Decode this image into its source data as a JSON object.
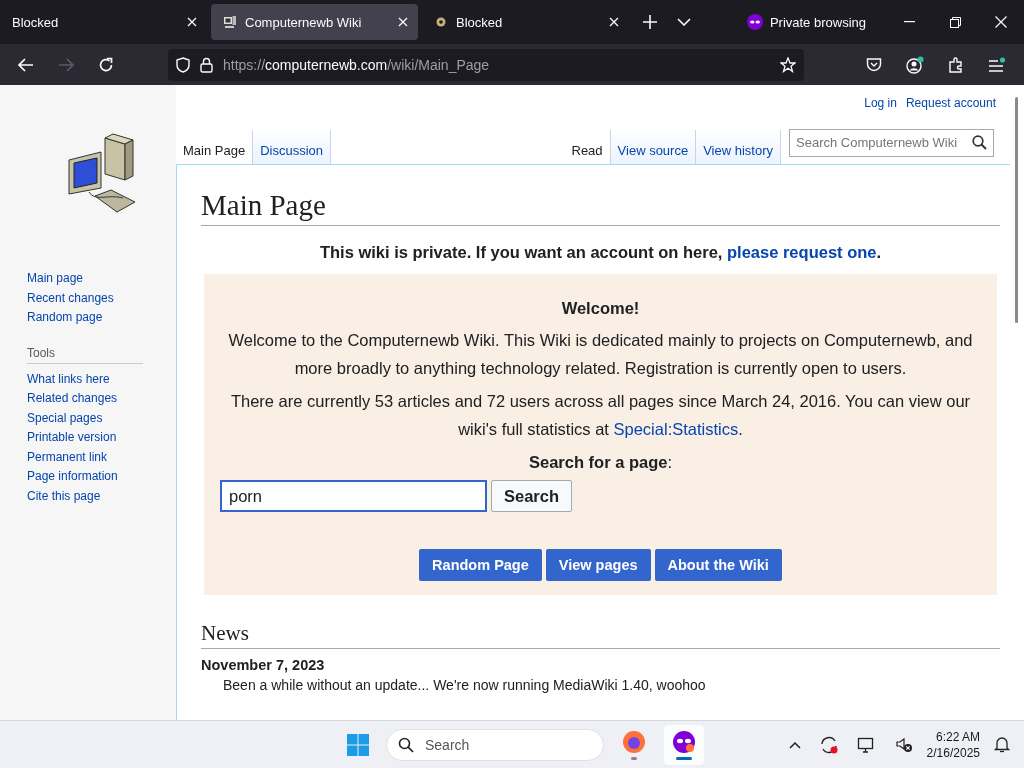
{
  "browser": {
    "tabs": [
      {
        "title": "Blocked",
        "selected": false,
        "kind": "plain"
      },
      {
        "title": "Computernewb Wiki",
        "selected": true,
        "kind": "wiki"
      },
      {
        "title": "Blocked",
        "selected": false,
        "kind": "blocked"
      }
    ],
    "private_label": "Private browsing",
    "forward_disabled": true,
    "url": {
      "scheme": "https://",
      "host": "computernewb.com",
      "path": "/wiki/Main_Page"
    }
  },
  "wiki": {
    "personal_links": [
      "Log in",
      "Request account"
    ],
    "page_tabs": [
      {
        "label": "Main Page",
        "selected": true
      },
      {
        "label": "Discussion",
        "selected": false
      }
    ],
    "view_tabs": [
      {
        "label": "Read",
        "selected": true
      },
      {
        "label": "View source",
        "selected": false
      },
      {
        "label": "View history",
        "selected": false
      }
    ],
    "search": {
      "placeholder": "Search Computernewb Wiki"
    },
    "navigation": [
      "Main page",
      "Recent changes",
      "Random page"
    ],
    "tools_heading": "Tools",
    "tools": [
      "What links here",
      "Related changes",
      "Special pages",
      "Printable version",
      "Permanent link",
      "Page information",
      "Cite this page"
    ],
    "title": "Main Page",
    "notice": {
      "text": "This wiki is private. If you want an account on here, ",
      "link": "please request one",
      "end": "."
    },
    "welcome": {
      "heading": "Welcome!",
      "paragraphs": [
        {
          "text": "Welcome to the Computernewb Wiki. This Wiki is dedicated mainly to projects on Computernewb, and more broadly to anything technology related. Registration is currently open to users."
        },
        {
          "text": "There are currently 53 articles and 72 users across all pages since March 24, 2016. You can view our wiki's full statistics at ",
          "link": "Special:Statistics",
          "end": "."
        }
      ],
      "search_label": "**Search for a page**:",
      "search_value": "porn",
      "search_button": "Search",
      "buttons": [
        "Random Page",
        "View pages",
        "About the Wiki"
      ]
    },
    "news": {
      "heading": "News",
      "date": "November 7, 2023",
      "item": "Been a while without an update... We're now running MediaWiki 1.40, woohoo"
    }
  },
  "taskbar": {
    "search": {
      "placeholder": "Search"
    },
    "apps": [
      {
        "kind": "firefox",
        "selected": false
      },
      {
        "kind": "private",
        "selected": true
      }
    ],
    "time": "6:22 AM",
    "date": "2/16/2025"
  }
}
